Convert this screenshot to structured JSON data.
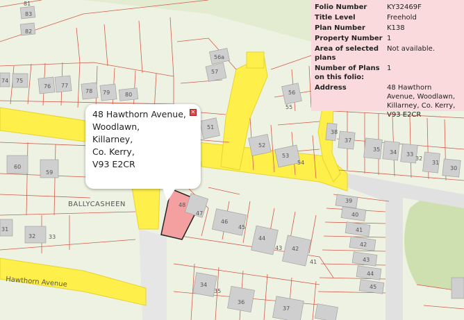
{
  "info": {
    "rows": [
      {
        "label": "Folio Number",
        "value": "KY32469F"
      },
      {
        "label": "Title Level",
        "value": "Freehold"
      },
      {
        "label": "Plan Number",
        "value": "K138"
      },
      {
        "label": "Property Number",
        "value": "1"
      },
      {
        "label": "Area of selected plans",
        "value": "Not available."
      },
      {
        "label": "Number of Plans on this folio:",
        "value": "1"
      },
      {
        "label": "Address",
        "value": "48 Hawthorn Avenue, Woodlawn, Killarney, Co. Kerry, V93 E2CR"
      }
    ]
  },
  "popup": {
    "lines": [
      "48 Hawthorn Avenue,",
      "Woodlawn,",
      "Killarney,",
      "Co. Kerry,",
      "V93 E2CR"
    ],
    "close_icon": "close-icon"
  },
  "map": {
    "place_name": "BALLYCASHEEN",
    "road_name": "Hawthorn Avenue",
    "house_numbers": [
      "83",
      "82",
      "81",
      "74",
      "75",
      "76",
      "77",
      "78",
      "79",
      "80",
      "56a",
      "57",
      "56",
      "55",
      "51",
      "52",
      "53",
      "54",
      "38",
      "37",
      "35",
      "34",
      "33",
      "32",
      "31",
      "30",
      "60",
      "59",
      "39",
      "40",
      "41",
      "42",
      "43",
      "44",
      "45",
      "46",
      "31",
      "32",
      "33",
      "46",
      "45",
      "44",
      "43",
      "42",
      "41",
      "47",
      "48",
      "34",
      "35",
      "36",
      "37"
    ],
    "colors": {
      "road": "#ffef4a",
      "boundary": "#d45a4a",
      "selected_plot": "#f4a0a0",
      "background": "#eef2e2",
      "building": "#cfcfcf",
      "green": "#cfe0b0"
    }
  }
}
